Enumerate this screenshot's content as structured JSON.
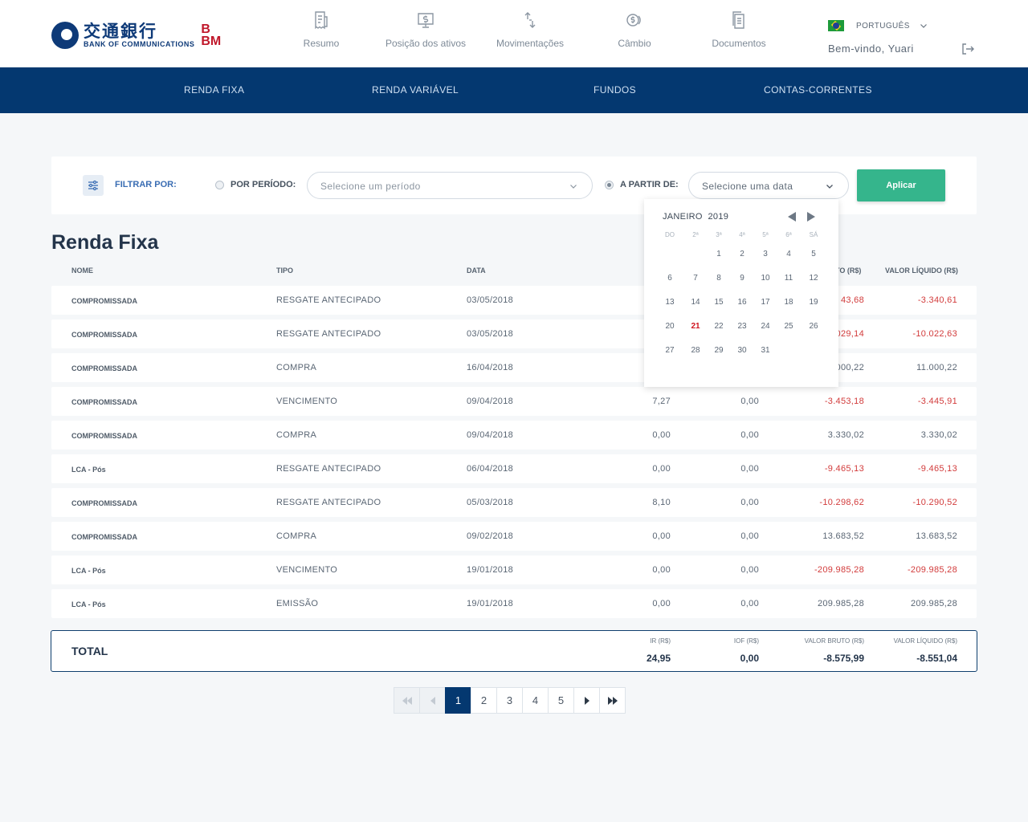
{
  "brand": {
    "cn": "交通銀行",
    "en": "BANK OF COMMUNICATIONS",
    "bbm_top": "B",
    "bbm_bottom": "BM"
  },
  "topnav": [
    {
      "label": "Resumo",
      "icon": "receipt-icon"
    },
    {
      "label": "Posição dos ativos",
      "icon": "monitor-dollar-icon"
    },
    {
      "label": "Movimentações",
      "icon": "transfer-arrows-icon"
    },
    {
      "label": "Câmbio",
      "icon": "currency-exchange-icon"
    },
    {
      "label": "Documentos",
      "icon": "documents-icon"
    }
  ],
  "language": {
    "label": "PORTUGUÊS",
    "flag": "brazil-flag-icon"
  },
  "user": {
    "welcome": "Bem-vindo, Yuari"
  },
  "subnav": [
    "RENDA FIXA",
    "RENDA VARIÁVEL",
    "FUNDOS",
    "CONTAS-CORRENTES"
  ],
  "filter": {
    "label": "FILTRAR POR:",
    "period_label": "POR PERÍODO:",
    "period_placeholder": "Selecione um período",
    "from_label": "A PARTIR DE:",
    "date_placeholder": "Selecione uma data",
    "apply": "Aplicar"
  },
  "page_title": "Renda Fixa",
  "table": {
    "columns": [
      "NOME",
      "TIPO",
      "DATA",
      "IR (R$)",
      "IOF (R$)",
      "VALOR BRUTO (R$)",
      "VALOR LÍQUIDO (R$)"
    ],
    "visible_headers": {
      "nome": "NOME",
      "tipo": "TIPO",
      "data": "DATA",
      "bruto_partial": "TO (R$)",
      "liquido": "VALOR LÍQUIDO (R$)"
    },
    "rows": [
      {
        "nome": "COMPROMISSADA",
        "tipo": "RESGATE ANTECIPADO",
        "data": "03/05/2018",
        "ir": "",
        "iof": "",
        "bruto": "43,68",
        "liquido": "-3.340,61"
      },
      {
        "nome": "COMPROMISSADA",
        "tipo": "RESGATE ANTECIPADO",
        "data": "03/05/2018",
        "ir": "",
        "iof": "",
        "bruto": "029,14",
        "liquido": "-10.022,63"
      },
      {
        "nome": "COMPROMISSADA",
        "tipo": "COMPRA",
        "data": "16/04/2018",
        "ir": "",
        "iof": "",
        "bruto": "000,22",
        "liquido": "11.000,22"
      },
      {
        "nome": "COMPROMISSADA",
        "tipo": "VENCIMENTO",
        "data": "09/04/2018",
        "ir": "7,27",
        "iof": "0,00",
        "bruto": "-3.453,18",
        "liquido": "-3.445,91"
      },
      {
        "nome": "COMPROMISSADA",
        "tipo": "COMPRA",
        "data": "09/04/2018",
        "ir": "0,00",
        "iof": "0,00",
        "bruto": "3.330,02",
        "liquido": "3.330,02"
      },
      {
        "nome": "LCA - Pós",
        "tipo": "RESGATE ANTECIPADO",
        "data": "06/04/2018",
        "ir": "0,00",
        "iof": "0,00",
        "bruto": "-9.465,13",
        "liquido": "-9.465,13"
      },
      {
        "nome": "COMPROMISSADA",
        "tipo": "RESGATE ANTECIPADO",
        "data": "05/03/2018",
        "ir": "8,10",
        "iof": "0,00",
        "bruto": "-10.298,62",
        "liquido": "-10.290,52"
      },
      {
        "nome": "COMPROMISSADA",
        "tipo": "COMPRA",
        "data": "09/02/2018",
        "ir": "0,00",
        "iof": "0,00",
        "bruto": "13.683,52",
        "liquido": "13.683,52"
      },
      {
        "nome": "LCA - Pós",
        "tipo": "VENCIMENTO",
        "data": "19/01/2018",
        "ir": "0,00",
        "iof": "0,00",
        "bruto": "-209.985,28",
        "liquido": "-209.985,28"
      },
      {
        "nome": "LCA - Pós",
        "tipo": "EMISSÃO",
        "data": "19/01/2018",
        "ir": "0,00",
        "iof": "0,00",
        "bruto": "209.985,28",
        "liquido": "209.985,28"
      }
    ]
  },
  "total": {
    "label": "TOTAL",
    "ir_label": "IR (R$)",
    "ir": "24,95",
    "iof_label": "IOF (R$)",
    "iof": "0,00",
    "bruto_label": "VALOR BRUTO (R$)",
    "bruto": "-8.575,99",
    "liquido_label": "VALOR LÍQUIDO (R$)",
    "liquido": "-8.551,04"
  },
  "pagination": {
    "pages": [
      "1",
      "2",
      "3",
      "4",
      "5"
    ],
    "current": "1"
  },
  "calendar": {
    "month": "JANEIRO",
    "year": "2019",
    "weekdays": [
      "DO",
      "2ª",
      "3ª",
      "4ª",
      "5ª",
      "6ª",
      "SÁ"
    ],
    "days": [
      "1",
      "2",
      "3",
      "4",
      "5",
      "6",
      "7",
      "8",
      "9",
      "10",
      "11",
      "12",
      "13",
      "14",
      "15",
      "16",
      "17",
      "18",
      "19",
      "20",
      "21",
      "22",
      "23",
      "24",
      "25",
      "26",
      "27",
      "28",
      "29",
      "30",
      "31"
    ],
    "first_weekday": 2,
    "today": "21"
  },
  "colors": {
    "primary": "#043870",
    "accent": "#35b58c",
    "negative": "#d23b3b",
    "today": "#d0141f"
  }
}
